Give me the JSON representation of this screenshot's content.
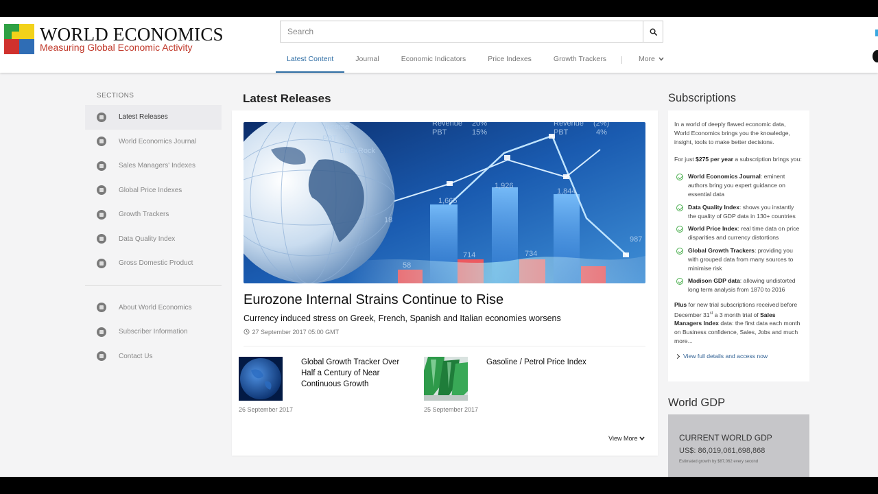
{
  "brand": {
    "title": "WORLD ECONOMICS",
    "tagline": "Measuring Global Economic Activity",
    "colors": {
      "yellow": "#f2d21a",
      "red": "#d0312d",
      "blue": "#2f6db5",
      "green": "#2ea043",
      "tagline": "#c0392b"
    }
  },
  "search": {
    "placeholder": "Search",
    "icon": "search-icon"
  },
  "nav": {
    "items": [
      {
        "label": "Latest Content",
        "active": true
      },
      {
        "label": "Journal"
      },
      {
        "label": "Economic Indicators"
      },
      {
        "label": "Price Indexes"
      },
      {
        "label": "Growth Trackers"
      }
    ],
    "more_label": "More"
  },
  "sidebar": {
    "heading": "SECTIONS",
    "items": [
      {
        "label": "Latest Releases",
        "icon": "globe-icon",
        "active": true
      },
      {
        "label": "World Economics Journal",
        "icon": "journal-icon"
      },
      {
        "label": "Sales Managers' Indexes",
        "icon": "bar-chart-icon"
      },
      {
        "label": "Global Price Indexes",
        "icon": "price-tag-icon"
      },
      {
        "label": "Growth Trackers",
        "icon": "trend-icon"
      },
      {
        "label": "Data Quality Index",
        "icon": "quality-icon"
      },
      {
        "label": "Gross Domestic Product",
        "icon": "document-icon"
      }
    ],
    "secondary": [
      {
        "label": "About World Economics",
        "icon": "info-icon"
      },
      {
        "label": "Subscriber Information",
        "icon": "subscriber-icon"
      },
      {
        "label": "Contact Us",
        "icon": "contact-icon"
      }
    ]
  },
  "main": {
    "title": "Latest Releases",
    "featured": {
      "headline": "Eurozone Internal Strains Continue to Rise",
      "subhead": "Currency induced stress on Greek, French, Spanish and Italian economies worsens",
      "date": "27 September 2017 05:00 GMT",
      "image_text": {
        "label_income": "Income",
        "label_pbt_left": "PBT",
        "label_blackrock": "BlackRock",
        "label_revenue_mid": "Revenue",
        "label_pbt_mid": "PBT",
        "value_mid_top": "20%",
        "value_mid_bottom": "15%",
        "label_revenue_right": "Revenue",
        "label_pbt_right": "PBT",
        "value_right_top": "(2%)",
        "value_right_bottom": "4%",
        "num_1665": "1,665",
        "num_1926": "1,926",
        "num_1844": "1,844",
        "num_987": "987",
        "num_714": "714",
        "num_734": "734",
        "num_58": "58",
        "num_18": "18"
      }
    },
    "articles": [
      {
        "title": "Global Growth Tracker Over Half a Century of Near Continuous Growth",
        "date": "26 September 2017"
      },
      {
        "title": "Gasoline / Petrol Price Index",
        "date": "25 September 2017"
      }
    ],
    "view_more": "View More"
  },
  "subscriptions": {
    "title": "Subscriptions",
    "intro": "In a world of deeply flawed economic data, World Economics brings you the knowledge, insight, tools to make better decisions.",
    "price_pre": "For just ",
    "price": "$275 per year",
    "price_post": " a subscription brings you:",
    "features": [
      {
        "name": "World Economics Journal",
        "text": ": eminent authors bring you expert guidance on essential data"
      },
      {
        "name": "Data Quality Index",
        "text": ": shows you instantly the quality of GDP data in 130+ countries"
      },
      {
        "name": "World Price Index",
        "text": ": real time data on price disparities and currency distortions"
      },
      {
        "name": "Global Growth Trackers",
        "text": ": providing you with grouped data from many sources to minimise risk"
      },
      {
        "name": "Madison GDP data",
        "text": ": allowing undistorted long term analysis from 1870 to 2016"
      }
    ],
    "plus_lead": "Plus",
    "plus_a": " for new trial subscriptions received before December 31",
    "plus_sup": "st",
    "plus_b": " a 3 month trial of ",
    "plus_bold": "Sales Managers Index",
    "plus_c": " data: the first data each month on Business confidence, Sales, Jobs and much more...",
    "link": "View full details and access now"
  },
  "world_gdp": {
    "title": "World GDP",
    "label": "CURRENT WORLD GDP",
    "value": "US$: 86,019,061,698,868",
    "note": "Estimated growth by $87,062 every second"
  }
}
